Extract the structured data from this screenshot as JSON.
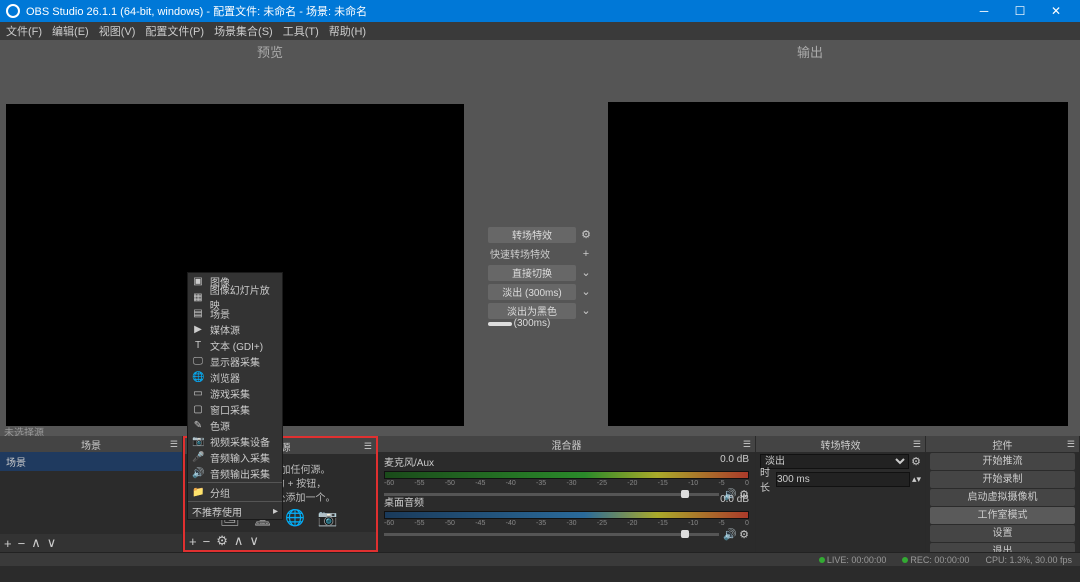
{
  "window": {
    "title": "OBS Studio 26.1.1 (64-bit, windows) - 配置文件: 未命名 - 场景: 未命名"
  },
  "menu": [
    "文件(F)",
    "编辑(E)",
    "视图(V)",
    "配置文件(P)",
    "场景集合(S)",
    "工具(T)",
    "帮助(H)"
  ],
  "preview": {
    "left_label": "预览",
    "right_label": "输出"
  },
  "transition_center": {
    "main_btn": "转场特效",
    "quick_label": "快速转场特效",
    "options": [
      "直接切换",
      "淡出 (300ms)",
      "淡出为黑色 (300ms)"
    ]
  },
  "context_menu": {
    "items": [
      {
        "icon": "image",
        "label": "图像"
      },
      {
        "icon": "slideshow",
        "label": "图像幻灯片放映"
      },
      {
        "icon": "scene",
        "label": "场景"
      },
      {
        "icon": "media",
        "label": "媒体源"
      },
      {
        "icon": "text",
        "label": "文本 (GDI+)"
      },
      {
        "icon": "display",
        "label": "显示器采集"
      },
      {
        "icon": "browser",
        "label": "浏览器"
      },
      {
        "icon": "game",
        "label": "游戏采集"
      },
      {
        "icon": "window",
        "label": "窗口采集"
      },
      {
        "icon": "color",
        "label": "色源"
      },
      {
        "icon": "camera",
        "label": "视频采集设备"
      },
      {
        "icon": "audioin",
        "label": "音频输入采集"
      },
      {
        "icon": "audioout",
        "label": "音频输出采集"
      }
    ],
    "group": "分组",
    "deprecated": "不推荐使用"
  },
  "unselected_hint": "未选择源",
  "panels": {
    "scenes": {
      "title": "场景",
      "items": [
        "场景"
      ]
    },
    "sources": {
      "title": "来源",
      "empty_line1": "您还没有添加任何源。",
      "empty_line2": "点击下面的 + 按钮，",
      "empty_line3": "或者右击此处添加一个。"
    },
    "mixer": {
      "title": "混合器",
      "tracks": [
        {
          "name": "麦克风/Aux",
          "level": "0.0 dB"
        },
        {
          "name": "桌面音频",
          "level": "0.0 dB"
        }
      ],
      "ticks": [
        "-60",
        "-55",
        "-50",
        "-45",
        "-40",
        "-35",
        "-30",
        "-25",
        "-20",
        "-15",
        "-10",
        "-5",
        "0"
      ]
    },
    "transitions": {
      "title": "转场特效",
      "selected": "淡出",
      "duration_label": "时长",
      "duration_value": "300 ms"
    },
    "controls": {
      "title": "控件",
      "buttons": [
        "开始推流",
        "开始录制",
        "启动虚拟摄像机",
        "工作室模式",
        "设置",
        "退出"
      ],
      "active_index": 3
    }
  },
  "statusbar": {
    "live": "LIVE: 00:00:00",
    "rec": "REC: 00:00:00",
    "cpu": "CPU: 1.3%, 30.00 fps"
  }
}
